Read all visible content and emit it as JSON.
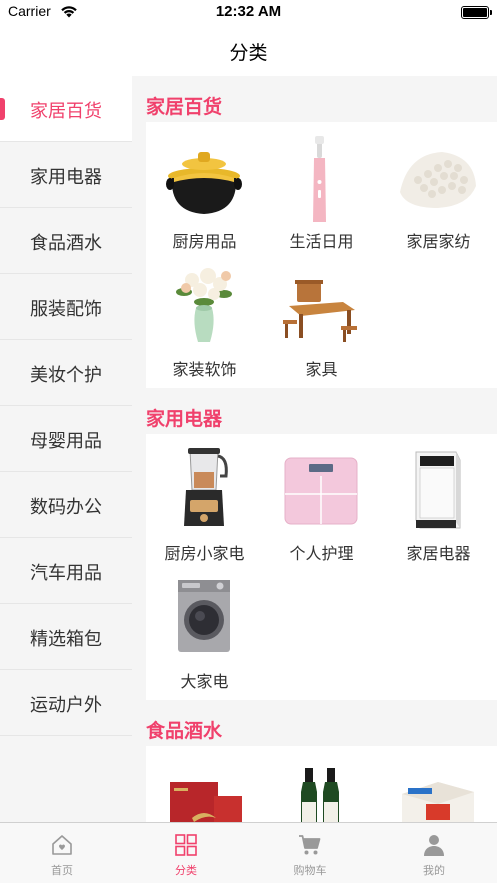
{
  "status": {
    "carrier": "Carrier",
    "time": "12:32 AM"
  },
  "nav": {
    "title": "分类"
  },
  "colors": {
    "accent": "#f0416c",
    "sidebar_bg": "#f5f5f5"
  },
  "sidebar": {
    "items": [
      {
        "label": "家居百货",
        "active": true
      },
      {
        "label": "家用电器"
      },
      {
        "label": "食品酒水"
      },
      {
        "label": "服装配饰"
      },
      {
        "label": "美妆个护"
      },
      {
        "label": "母婴用品"
      },
      {
        "label": "数码办公"
      },
      {
        "label": "汽车用品"
      },
      {
        "label": "精选箱包"
      },
      {
        "label": "运动户外"
      }
    ]
  },
  "sections": [
    {
      "title": "家居百货",
      "items": [
        {
          "label": "厨房用品",
          "icon": "clay-pot-image"
        },
        {
          "label": "生活日用",
          "icon": "electric-toothbrush-image"
        },
        {
          "label": "家居家纺",
          "icon": "latex-pillow-image"
        },
        {
          "label": "家装软饰",
          "icon": "flower-vase-image"
        },
        {
          "label": "家具",
          "icon": "tea-table-image"
        }
      ]
    },
    {
      "title": "家用电器",
      "items": [
        {
          "label": "厨房小家电",
          "icon": "blender-image"
        },
        {
          "label": "个人护理",
          "icon": "scale-image"
        },
        {
          "label": "家居电器",
          "icon": "air-purifier-image"
        },
        {
          "label": "大家电",
          "icon": "washing-machine-image"
        }
      ]
    },
    {
      "title": "食品酒水",
      "items": [
        {
          "label": "",
          "icon": "gift-box-image"
        },
        {
          "label": "",
          "icon": "oil-bottles-image"
        },
        {
          "label": "",
          "icon": "snack-box-image"
        }
      ]
    }
  ],
  "tabbar": {
    "tabs": [
      {
        "label": "首页",
        "icon": "home-icon"
      },
      {
        "label": "分类",
        "icon": "category-grid-icon",
        "active": true
      },
      {
        "label": "购物车",
        "icon": "cart-icon"
      },
      {
        "label": "我的",
        "icon": "user-icon"
      }
    ]
  }
}
